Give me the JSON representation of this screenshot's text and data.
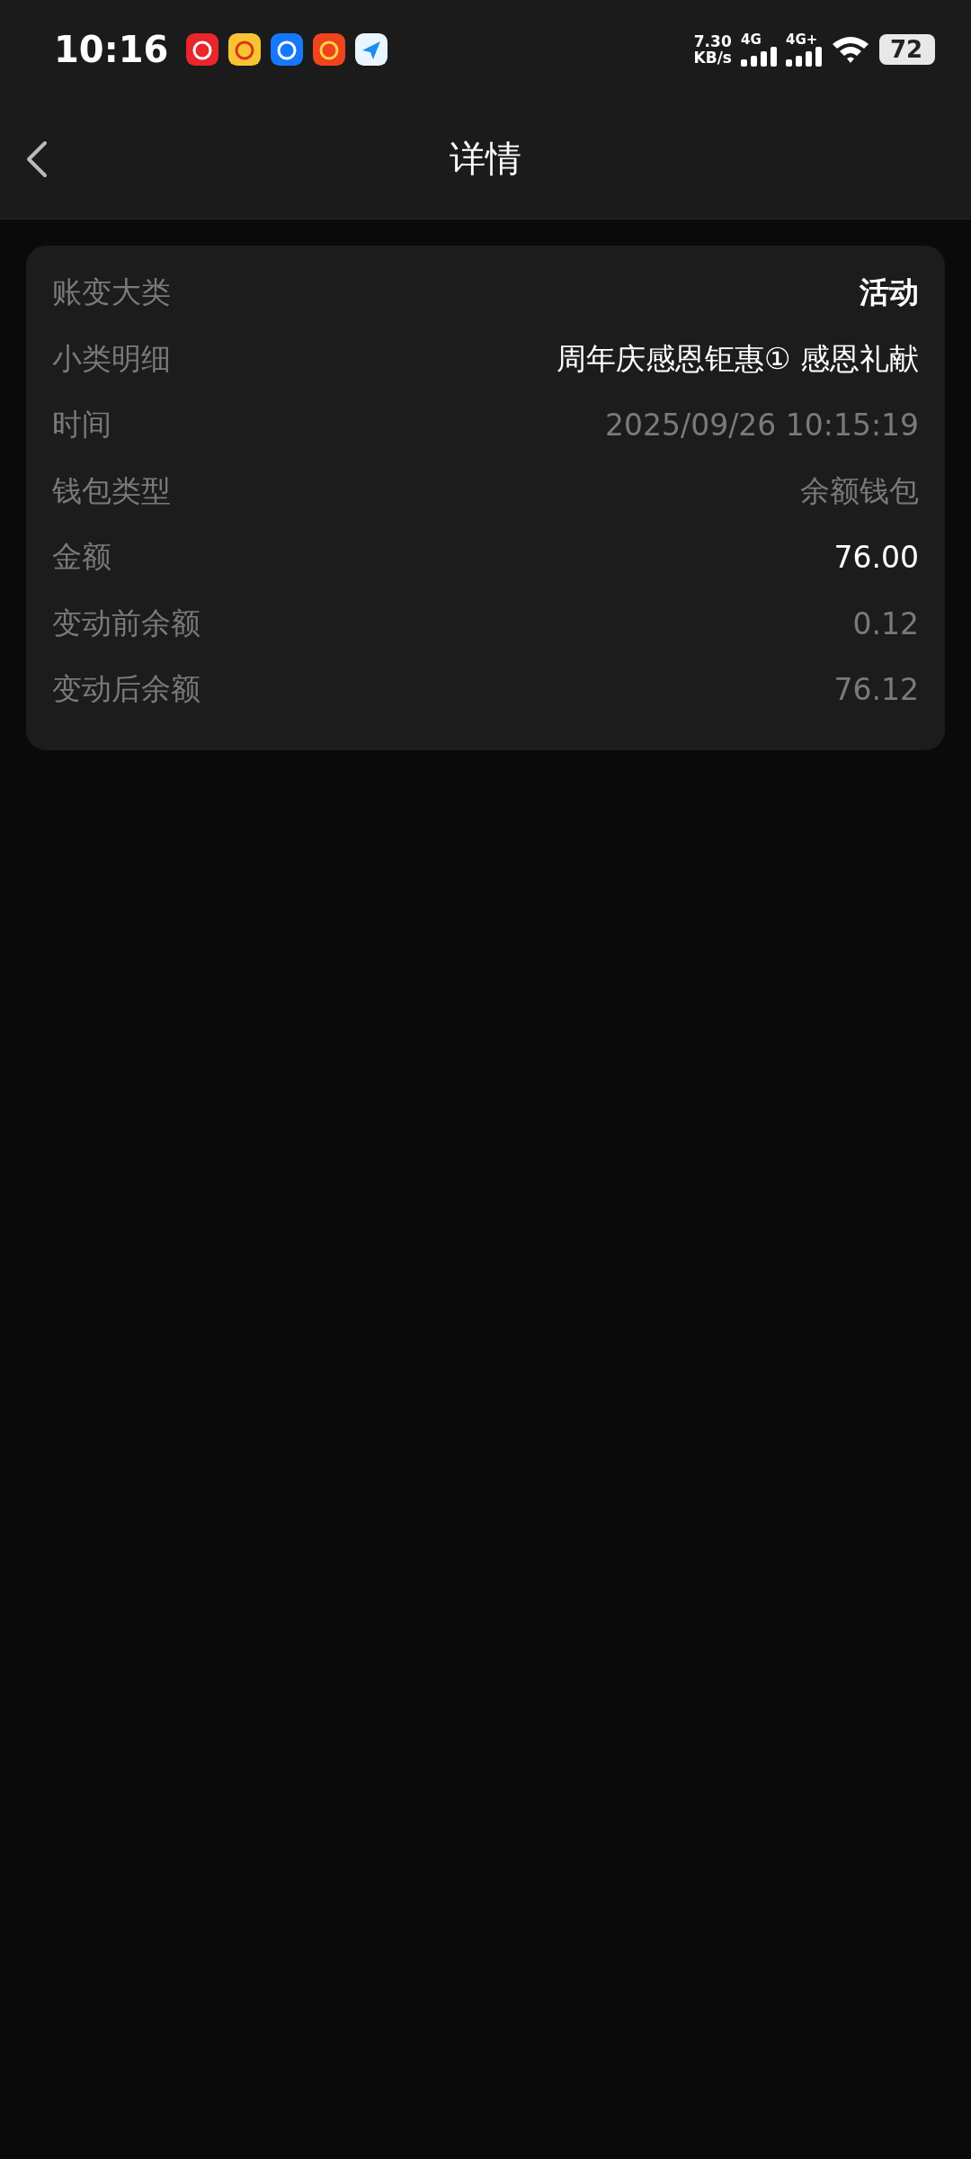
{
  "status_bar": {
    "time": "10:16",
    "speed_value": "7.30",
    "speed_unit": "KB/s",
    "sim1": "4G",
    "sim2": "4G+",
    "battery": "72"
  },
  "header": {
    "title": "详情"
  },
  "details": [
    {
      "label": "账变大类",
      "value": "活动",
      "kind": "strong"
    },
    {
      "label": "小类明细",
      "value": "周年庆感恩钜惠① 感恩礼献",
      "kind": "bright"
    },
    {
      "label": "时间",
      "value": "2025/09/26 10:15:19",
      "kind": "muted"
    },
    {
      "label": "钱包类型",
      "value": "余额钱包",
      "kind": "muted"
    },
    {
      "label": "金额",
      "value": "76.00",
      "kind": "bright"
    },
    {
      "label": "变动前余额",
      "value": "0.12",
      "kind": "muted"
    },
    {
      "label": "变动后余额",
      "value": "76.12",
      "kind": "muted"
    }
  ]
}
